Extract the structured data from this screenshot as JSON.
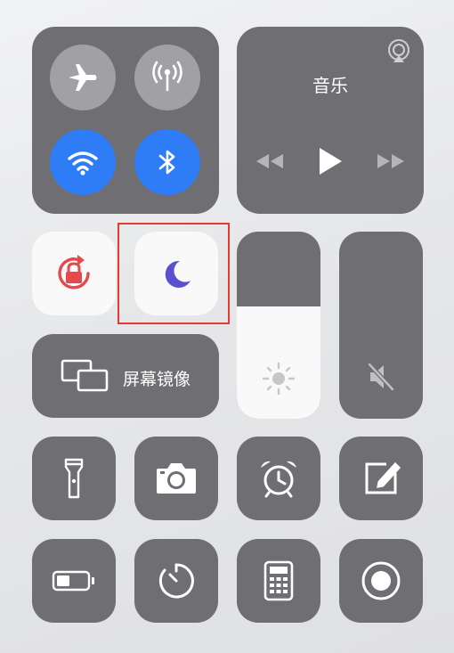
{
  "colors": {
    "tile": "#6f6f73",
    "tile_white": "#f9f9fa",
    "circle_inactive": "#a1a1a5",
    "active_blue": "#2e7cf6",
    "rotation_lock_red": "#e5484d",
    "dnd_purple": "#5a4fcf",
    "highlight_red": "#e53935"
  },
  "connectivity": {
    "airplane": {
      "icon": "airplane-icon",
      "active": false
    },
    "cellular": {
      "icon": "cellular-antenna-icon",
      "active": false
    },
    "wifi": {
      "icon": "wifi-icon",
      "active": true
    },
    "bluetooth": {
      "icon": "bluetooth-icon",
      "active": true
    }
  },
  "music": {
    "title": "音乐",
    "airplay_icon": "airplay-icon",
    "controls": [
      "rewind-icon",
      "play-icon",
      "fast-forward-icon"
    ]
  },
  "rotation_lock": {
    "icon": "rotation-lock-icon",
    "active": true
  },
  "do_not_disturb": {
    "icon": "moon-icon",
    "active": true,
    "highlighted": true
  },
  "screen_mirroring": {
    "label": "屏幕镜像",
    "icon": "screen-mirroring-icon"
  },
  "brightness": {
    "icon": "sun-icon",
    "level_fraction": 0.6
  },
  "volume": {
    "icon": "speaker-muted-icon",
    "level_fraction": 0
  },
  "shortcuts": [
    {
      "icon": "flashlight-icon"
    },
    {
      "icon": "camera-icon"
    },
    {
      "icon": "alarm-clock-icon"
    },
    {
      "icon": "notes-edit-icon"
    },
    {
      "icon": "low-power-battery-icon"
    },
    {
      "icon": "timer-icon"
    },
    {
      "icon": "calculator-icon"
    },
    {
      "icon": "screen-record-icon"
    }
  ]
}
